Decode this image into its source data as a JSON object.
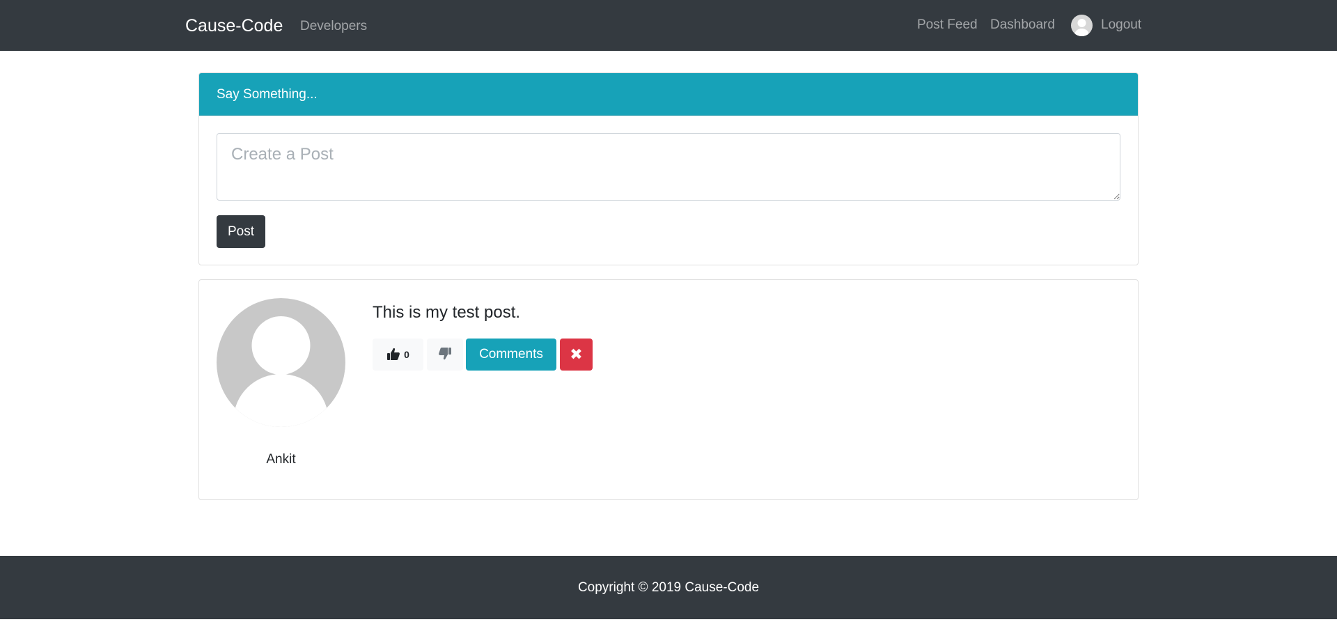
{
  "navbar": {
    "brand": "Cause-Code",
    "links": {
      "developers": "Developers",
      "post_feed": "Post Feed",
      "dashboard": "Dashboard",
      "logout": "Logout"
    },
    "background_color": "#343a40"
  },
  "post_form": {
    "header": "Say Something...",
    "textarea_placeholder": "Create a Post",
    "textarea_value": "",
    "submit_label": "Post",
    "header_color": "#17a2b8"
  },
  "posts": [
    {
      "author": "Ankit",
      "text": "This is my test post.",
      "likes": "0",
      "like_icon": "thumbs-up-icon",
      "unlike_icon": "thumbs-down-icon",
      "comments_label": "Comments",
      "delete_icon": "close-icon"
    }
  ],
  "footer": {
    "text": "Copyright © 2019 Cause-Code"
  },
  "colors": {
    "info": "#17a2b8",
    "danger": "#dc3545",
    "dark": "#343a40",
    "light": "#f8f9fa"
  }
}
